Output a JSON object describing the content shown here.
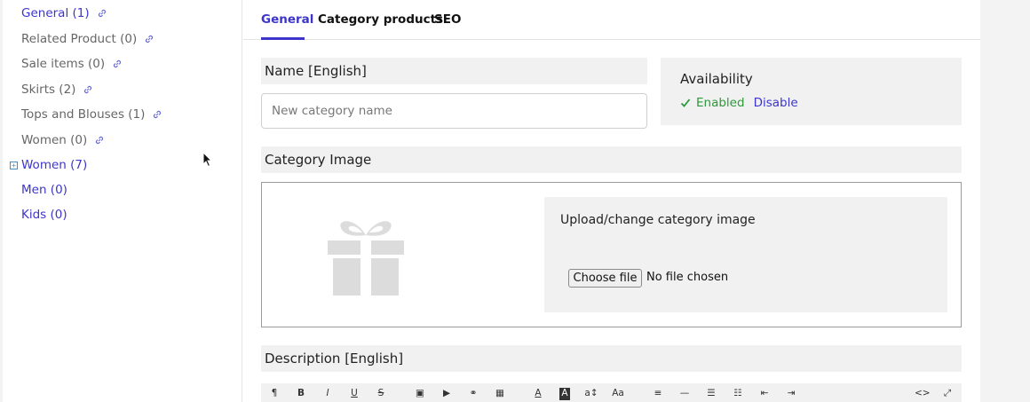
{
  "sidebar": {
    "items": [
      {
        "label": "General (1)",
        "color": "blue",
        "has_link": true
      },
      {
        "label": "Related Product (0)",
        "color": "gray",
        "has_link": true
      },
      {
        "label": "Sale items (0)",
        "color": "gray",
        "has_link": true
      },
      {
        "label": "Skirts (2)",
        "color": "gray",
        "has_link": true
      },
      {
        "label": "Tops and Blouses (1)",
        "color": "gray",
        "has_link": true
      },
      {
        "label": "Women (0)",
        "color": "gray",
        "has_link": true
      },
      {
        "label": "Women (7)",
        "color": "blue",
        "has_link": false,
        "expander": "+"
      },
      {
        "label": "Men (0)",
        "color": "blue",
        "has_link": false
      },
      {
        "label": "Kids (0)",
        "color": "blue",
        "has_link": false
      }
    ],
    "link_icon": "link-icon"
  },
  "tabs": [
    {
      "label": "General",
      "active": true
    },
    {
      "label": "Category products",
      "active": false
    },
    {
      "label": "SEO",
      "active": false
    }
  ],
  "name_section": {
    "heading": "Name [English]",
    "input_placeholder": "New category name",
    "input_value": ""
  },
  "availability": {
    "title": "Availability",
    "enabled_label": "Enabled",
    "disable_label": "Disable",
    "status_icon": "check-icon"
  },
  "image_section": {
    "heading": "Category Image",
    "placeholder_icon": "gift-icon",
    "upload_title": "Upload/change category image",
    "choose_button": "Choose file",
    "file_status": "No file chosen"
  },
  "description_section": {
    "heading": "Description [English]"
  },
  "editor_toolbar": {
    "buttons": [
      {
        "name": "paragraph",
        "glyph": "¶"
      },
      {
        "name": "bold",
        "glyph": "B"
      },
      {
        "name": "italic",
        "glyph": "I"
      },
      {
        "name": "underline",
        "glyph": "U"
      },
      {
        "name": "strikethrough",
        "glyph": "S"
      },
      {
        "name": "image",
        "glyph": "▣"
      },
      {
        "name": "video",
        "glyph": "▶"
      },
      {
        "name": "link",
        "glyph": "⚭"
      },
      {
        "name": "table",
        "glyph": "▦"
      },
      {
        "name": "font-color",
        "glyph": "A"
      },
      {
        "name": "highlight",
        "glyph": "A"
      },
      {
        "name": "font-size",
        "glyph": "a↕"
      },
      {
        "name": "format",
        "glyph": "Aa"
      },
      {
        "name": "align",
        "glyph": "≡"
      },
      {
        "name": "horizontal-rule",
        "glyph": "—"
      },
      {
        "name": "bullet-list",
        "glyph": "☰"
      },
      {
        "name": "numbered-list",
        "glyph": "☷"
      },
      {
        "name": "outdent",
        "glyph": "⇤"
      },
      {
        "name": "indent",
        "glyph": "⇥"
      },
      {
        "name": "code-view",
        "glyph": "<>"
      },
      {
        "name": "fullscreen",
        "glyph": "⤢"
      }
    ]
  },
  "colors": {
    "accent": "#3d35c9",
    "enabled_green": "#2a9a3a",
    "panel_gray": "#f1f1f1",
    "muted_text": "#666666"
  }
}
